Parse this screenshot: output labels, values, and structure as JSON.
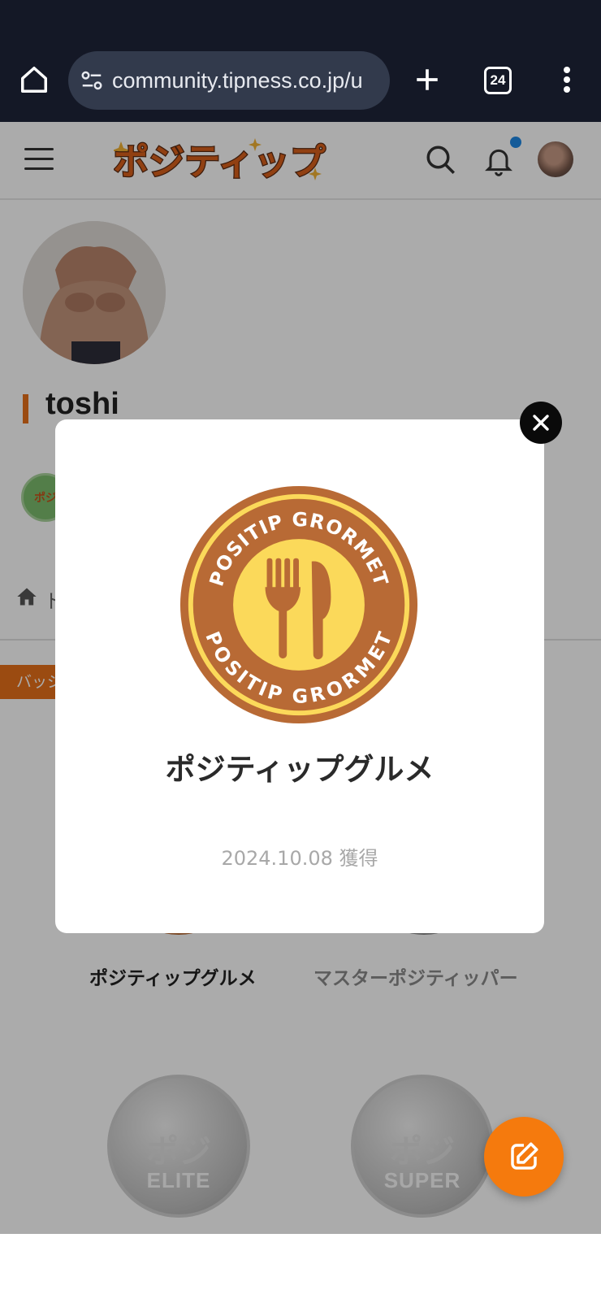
{
  "browser": {
    "url": "community.tipness.co.jp/u",
    "tab_count": "24"
  },
  "site": {
    "logo_text": "ポジティップ",
    "profile_name": "toshi",
    "small_badge_text": "ポジ",
    "crumb_text": "ト",
    "badge_tab_label": "バッジ",
    "badges": [
      {
        "label": "ポジティップグルメ"
      },
      {
        "label": "マスターポジティッパー"
      },
      {
        "label": "ELITE",
        "center": "ポジ"
      },
      {
        "label": "SUPER",
        "center": "ポジ"
      }
    ]
  },
  "modal": {
    "badge_ring_text": "POSITIP GRORMET",
    "title": "ポジティップグルメ",
    "date": "2024.10.08 獲得"
  },
  "colors": {
    "accent": "#f57a0d",
    "badge_brown": "#b86a35",
    "badge_yellow": "#fbd95a"
  }
}
